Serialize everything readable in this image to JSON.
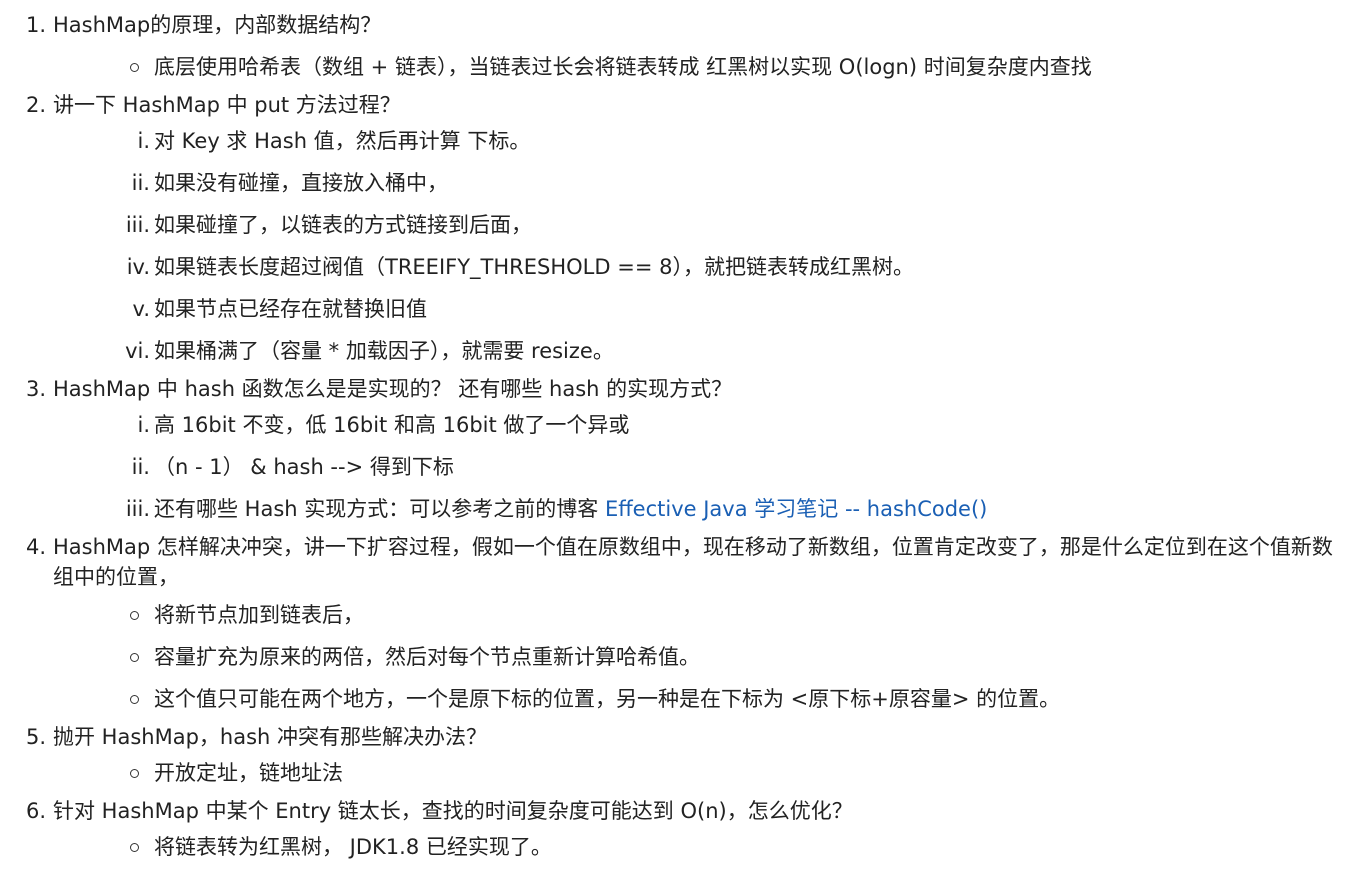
{
  "questions": [
    {
      "num": "1.",
      "text": "HashMap的原理，内部数据结构？",
      "subs": [
        {
          "marker": "",
          "text": "底层使用哈希表（数组 + 链表），当链表过长会将链表转成 红黑树以实现 O(logn) 时间复杂度内查找"
        }
      ]
    },
    {
      "num": "2.",
      "text": "讲一下 HashMap 中 put 方法过程？",
      "subs": [
        {
          "marker": "i.",
          "text": "对 Key 求 Hash 值，然后再计算 下标。"
        },
        {
          "marker": "ii.",
          "text": "如果没有碰撞，直接放入桶中，"
        },
        {
          "marker": "iii.",
          "text": "如果碰撞了，以链表的方式链接到后面，"
        },
        {
          "marker": "iv.",
          "text": "如果链表长度超过阀值（TREEIFY_THRESHOLD == 8），就把链表转成红黑树。"
        },
        {
          "marker": "v.",
          "text": "如果节点已经存在就替换旧值"
        },
        {
          "marker": "vi.",
          "text": "如果桶满了（容量 * 加载因子），就需要 resize。"
        }
      ]
    },
    {
      "num": "3.",
      "text": "HashMap 中 hash 函数怎么是是实现的？ 还有哪些 hash 的实现方式？",
      "subs": [
        {
          "marker": "i.",
          "text": "高 16bit 不变，低 16bit 和高 16bit 做了一个异或"
        },
        {
          "marker": "ii.",
          "text": "（n - 1） & hash --> 得到下标"
        },
        {
          "marker": "iii.",
          "text": "还有哪些 Hash 实现方式：可以参考之前的博客 ",
          "link": "Effective Java 学习笔记 -- hashCode()"
        }
      ]
    },
    {
      "num": "4.",
      "text": "HashMap 怎样解决冲突，讲一下扩容过程，假如一个值在原数组中，现在移动了新数组，位置肯定改变了，那是什么定位到在这个值新数组中的位置，",
      "subs": [
        {
          "marker": "",
          "text": "将新节点加到链表后，"
        },
        {
          "marker": "",
          "text": "容量扩充为原来的两倍，然后对每个节点重新计算哈希值。"
        },
        {
          "marker": "",
          "text": "这个值只可能在两个地方，一个是原下标的位置，另一种是在下标为 <原下标+原容量> 的位置。"
        }
      ]
    },
    {
      "num": "5.",
      "text": "抛开 HashMap，hash 冲突有那些解决办法？",
      "subs": [
        {
          "marker": "",
          "text": "开放定址，链地址法"
        }
      ]
    },
    {
      "num": "6.",
      "text": "针对 HashMap 中某个 Entry 链太长，查找的时间复杂度可能达到 O(n)，怎么优化？",
      "subs": [
        {
          "marker": "",
          "text": "将链表转为红黑树， JDK1.8 已经实现了。"
        }
      ]
    }
  ]
}
